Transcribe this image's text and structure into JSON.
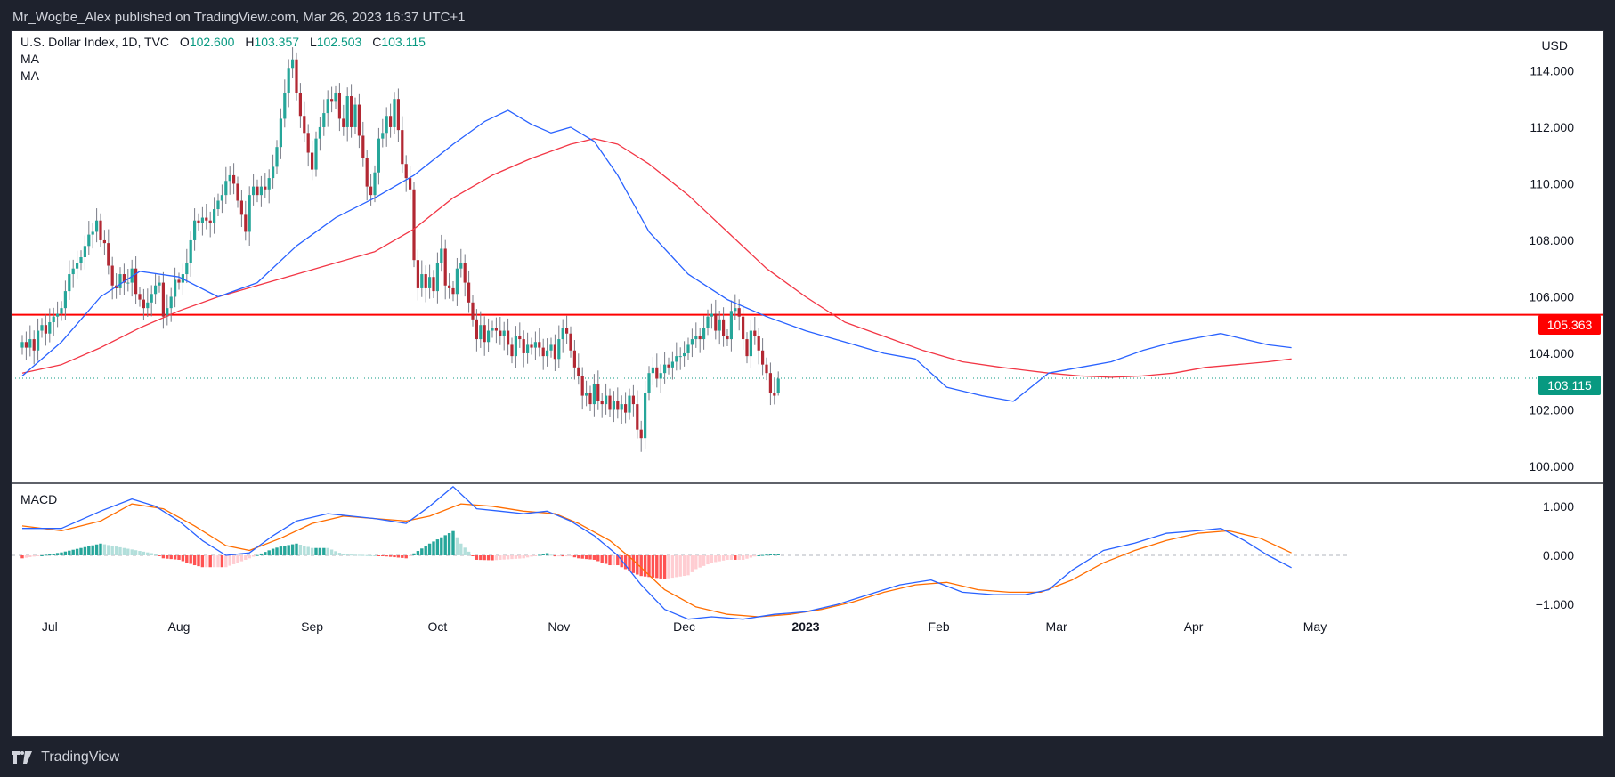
{
  "header": {
    "publisher_line": "Mr_Wogbe_Alex published on TradingView.com, Mar 26, 2023 16:37 UTC+1"
  },
  "legend": {
    "symbol": "U.S. Dollar Index, 1D, TVC",
    "open_label": "O",
    "open_value": "102.600",
    "high_label": "H",
    "high_value": "103.357",
    "low_label": "L",
    "low_value": "102.503",
    "close_label": "C",
    "close_value": "103.115",
    "ma1": "MA",
    "ma2": "MA",
    "macd": "MACD"
  },
  "price_axis": {
    "currency": "USD",
    "ticks": [
      "114.000",
      "112.000",
      "110.000",
      "108.000",
      "106.000",
      "104.000",
      "102.000",
      "100.000"
    ]
  },
  "macd_axis": {
    "ticks": [
      "1.000",
      "0.000",
      "−1.000"
    ]
  },
  "time_axis": {
    "labels": [
      "Jul",
      "Aug",
      "Sep",
      "Oct",
      "Nov",
      "Dec",
      "2023",
      "Feb",
      "Mar",
      "Apr",
      "May"
    ]
  },
  "tags": {
    "resistance": "105.363",
    "last_price": "103.115"
  },
  "footer": {
    "brand": "TradingView"
  },
  "colors": {
    "up": "#089981",
    "down": "#f23645",
    "up_candle": "#26a69a",
    "down_candle": "#b22833",
    "ma_fast": "#2962ff",
    "ma_slow": "#f23645",
    "macd": "#2962ff",
    "signal": "#ff6d00",
    "hist_up_strong": "#26a69a",
    "hist_up_weak": "#b2dfdb",
    "hist_down_strong": "#ff5252",
    "hist_down_weak": "#ffcdd2",
    "resistance": "#ff0000"
  },
  "chart_data": {
    "type": "candlestick",
    "symbol": "U.S. Dollar Index",
    "interval": "1D",
    "last_ohlc": {
      "open": 102.6,
      "high": 103.357,
      "low": 102.503,
      "close": 103.115
    },
    "y_range": [
      99.4,
      115.4
    ],
    "horizontal_line": 105.363,
    "last_price": 103.115,
    "closes": [
      104.4,
      104.2,
      104.5,
      104.1,
      104.8,
      105.0,
      104.7,
      105.1,
      105.3,
      105.4,
      105.6,
      106.2,
      106.8,
      107.0,
      107.2,
      107.4,
      107.8,
      108.2,
      108.3,
      108.7,
      108.0,
      107.9,
      107.1,
      106.4,
      106.3,
      106.8,
      106.5,
      106.5,
      107.0,
      106.1,
      105.9,
      105.6,
      105.8,
      106.1,
      106.4,
      106.5,
      105.3,
      105.6,
      106.0,
      106.6,
      106.5,
      106.8,
      107.2,
      108.0,
      108.7,
      108.6,
      108.8,
      108.7,
      108.6,
      109.1,
      109.4,
      109.6,
      110.1,
      110.3,
      110.0,
      109.4,
      108.9,
      108.3,
      109.6,
      109.9,
      109.6,
      109.9,
      109.8,
      110.2,
      110.6,
      111.3,
      112.3,
      113.2,
      114.1,
      114.4,
      113.2,
      112.4,
      111.8,
      111.1,
      110.5,
      111.6,
      112.0,
      112.5,
      113.0,
      112.9,
      113.2,
      112.3,
      112.0,
      113.1,
      112.0,
      112.8,
      111.7,
      110.9,
      109.9,
      109.6,
      110.4,
      111.6,
      111.8,
      112.4,
      112.0,
      113.0,
      111.9,
      110.7,
      110.2,
      109.8,
      107.3,
      106.3,
      106.8,
      106.3,
      106.7,
      106.2,
      107.2,
      107.7,
      106.4,
      106.3,
      106.1,
      107.0,
      107.2,
      106.5,
      105.8,
      105.2,
      104.5,
      105.0,
      104.4,
      104.8,
      104.9,
      104.8,
      104.6,
      104.8,
      104.3,
      103.9,
      104.6,
      104.5,
      104.0,
      104.3,
      104.2,
      104.4,
      104.2,
      103.9,
      104.1,
      104.3,
      103.8,
      104.5,
      104.9,
      104.7,
      104.1,
      103.5,
      103.2,
      102.5,
      102.6,
      102.2,
      102.9,
      102.3,
      102.2,
      102.5,
      102.0,
      102.3,
      102.0,
      102.2,
      101.9,
      102.5,
      102.2,
      101.3,
      101.0,
      102.6,
      103.3,
      103.5,
      103.1,
      103.3,
      103.6,
      103.5,
      103.7,
      103.9,
      103.9,
      104.0,
      104.3,
      104.5,
      104.6,
      104.5,
      104.9,
      105.3,
      105.4,
      104.8,
      105.2,
      104.6,
      104.5,
      105.5,
      105.6,
      105.3,
      104.5,
      103.9,
      104.8,
      104.6,
      104.1,
      103.6,
      103.3,
      102.6,
      102.5,
      103.1
    ],
    "ma_fast": [
      [
        0,
        103.2
      ],
      [
        10,
        104.4
      ],
      [
        20,
        106.0
      ],
      [
        30,
        106.9
      ],
      [
        40,
        106.7
      ],
      [
        50,
        106.0
      ],
      [
        60,
        106.5
      ],
      [
        70,
        107.8
      ],
      [
        80,
        108.8
      ],
      [
        90,
        109.5
      ],
      [
        100,
        110.3
      ],
      [
        110,
        111.4
      ],
      [
        118,
        112.2
      ],
      [
        124,
        112.6
      ],
      [
        130,
        112.1
      ],
      [
        135,
        111.8
      ],
      [
        140,
        112.0
      ],
      [
        146,
        111.5
      ],
      [
        152,
        110.3
      ],
      [
        160,
        108.3
      ],
      [
        170,
        106.8
      ],
      [
        180,
        105.9
      ],
      [
        190,
        105.3
      ],
      [
        200,
        104.8
      ],
      [
        210,
        104.4
      ],
      [
        220,
        104.0
      ],
      [
        228,
        103.8
      ],
      [
        236,
        102.8
      ],
      [
        245,
        102.5
      ],
      [
        253,
        102.3
      ],
      [
        262,
        103.3
      ],
      [
        270,
        103.5
      ],
      [
        278,
        103.7
      ],
      [
        286,
        104.1
      ],
      [
        294,
        104.4
      ],
      [
        302,
        104.6
      ],
      [
        306,
        104.7
      ],
      [
        312,
        104.5
      ],
      [
        318,
        104.3
      ],
      [
        324,
        104.2
      ]
    ],
    "ma_slow": [
      [
        0,
        103.3
      ],
      [
        10,
        103.6
      ],
      [
        20,
        104.2
      ],
      [
        30,
        104.9
      ],
      [
        40,
        105.5
      ],
      [
        50,
        106.0
      ],
      [
        60,
        106.4
      ],
      [
        70,
        106.8
      ],
      [
        80,
        107.2
      ],
      [
        90,
        107.6
      ],
      [
        100,
        108.4
      ],
      [
        110,
        109.5
      ],
      [
        120,
        110.3
      ],
      [
        130,
        110.9
      ],
      [
        140,
        111.4
      ],
      [
        146,
        111.6
      ],
      [
        152,
        111.4
      ],
      [
        160,
        110.7
      ],
      [
        170,
        109.6
      ],
      [
        180,
        108.3
      ],
      [
        190,
        107.0
      ],
      [
        200,
        106.0
      ],
      [
        210,
        105.1
      ],
      [
        220,
        104.6
      ],
      [
        230,
        104.1
      ],
      [
        240,
        103.7
      ],
      [
        250,
        103.5
      ],
      [
        262,
        103.3
      ],
      [
        270,
        103.2
      ],
      [
        278,
        103.15
      ],
      [
        286,
        103.2
      ],
      [
        294,
        103.3
      ],
      [
        302,
        103.5
      ],
      [
        310,
        103.6
      ],
      [
        318,
        103.7
      ],
      [
        324,
        103.8
      ]
    ],
    "macd_range": [
      -1.45,
      1.45
    ],
    "macd_line": [
      [
        0,
        0.55
      ],
      [
        10,
        0.55
      ],
      [
        20,
        0.9
      ],
      [
        28,
        1.15
      ],
      [
        34,
        1.0
      ],
      [
        40,
        0.7
      ],
      [
        46,
        0.3
      ],
      [
        52,
        0.0
      ],
      [
        58,
        0.05
      ],
      [
        64,
        0.4
      ],
      [
        70,
        0.7
      ],
      [
        78,
        0.85
      ],
      [
        84,
        0.8
      ],
      [
        90,
        0.75
      ],
      [
        98,
        0.65
      ],
      [
        104,
        1.0
      ],
      [
        110,
        1.4
      ],
      [
        116,
        0.95
      ],
      [
        122,
        0.9
      ],
      [
        128,
        0.85
      ],
      [
        134,
        0.9
      ],
      [
        140,
        0.7
      ],
      [
        146,
        0.4
      ],
      [
        152,
        0.0
      ],
      [
        158,
        -0.6
      ],
      [
        164,
        -1.1
      ],
      [
        170,
        -1.3
      ],
      [
        176,
        -1.25
      ],
      [
        184,
        -1.3
      ],
      [
        192,
        -1.2
      ],
      [
        200,
        -1.15
      ],
      [
        208,
        -1.0
      ],
      [
        216,
        -0.8
      ],
      [
        224,
        -0.6
      ],
      [
        232,
        -0.5
      ],
      [
        240,
        -0.75
      ],
      [
        248,
        -0.8
      ],
      [
        256,
        -0.8
      ],
      [
        262,
        -0.7
      ],
      [
        268,
        -0.3
      ],
      [
        276,
        0.1
      ],
      [
        284,
        0.25
      ],
      [
        292,
        0.45
      ],
      [
        300,
        0.5
      ],
      [
        306,
        0.55
      ],
      [
        312,
        0.3
      ],
      [
        318,
        0.0
      ],
      [
        324,
        -0.25
      ]
    ],
    "signal_line": [
      [
        0,
        0.6
      ],
      [
        10,
        0.5
      ],
      [
        20,
        0.7
      ],
      [
        28,
        1.05
      ],
      [
        36,
        0.95
      ],
      [
        44,
        0.6
      ],
      [
        52,
        0.2
      ],
      [
        58,
        0.1
      ],
      [
        66,
        0.35
      ],
      [
        74,
        0.65
      ],
      [
        82,
        0.8
      ],
      [
        90,
        0.75
      ],
      [
        98,
        0.7
      ],
      [
        104,
        0.8
      ],
      [
        112,
        1.05
      ],
      [
        120,
        1.0
      ],
      [
        128,
        0.9
      ],
      [
        136,
        0.85
      ],
      [
        142,
        0.65
      ],
      [
        150,
        0.3
      ],
      [
        156,
        -0.1
      ],
      [
        164,
        -0.7
      ],
      [
        172,
        -1.05
      ],
      [
        180,
        -1.2
      ],
      [
        188,
        -1.25
      ],
      [
        196,
        -1.2
      ],
      [
        204,
        -1.1
      ],
      [
        212,
        -0.95
      ],
      [
        220,
        -0.75
      ],
      [
        228,
        -0.6
      ],
      [
        236,
        -0.55
      ],
      [
        244,
        -0.7
      ],
      [
        252,
        -0.75
      ],
      [
        260,
        -0.75
      ],
      [
        268,
        -0.5
      ],
      [
        276,
        -0.15
      ],
      [
        284,
        0.1
      ],
      [
        292,
        0.3
      ],
      [
        300,
        0.45
      ],
      [
        308,
        0.5
      ],
      [
        316,
        0.35
      ],
      [
        324,
        0.05
      ]
    ],
    "price_ticks": [
      114,
      112,
      110,
      108,
      106,
      104,
      102,
      100
    ],
    "macd_ticks": [
      1,
      0,
      -1
    ],
    "time_label_bars": [
      7,
      40,
      74,
      106,
      137,
      169,
      200,
      234,
      264,
      299,
      330
    ]
  }
}
